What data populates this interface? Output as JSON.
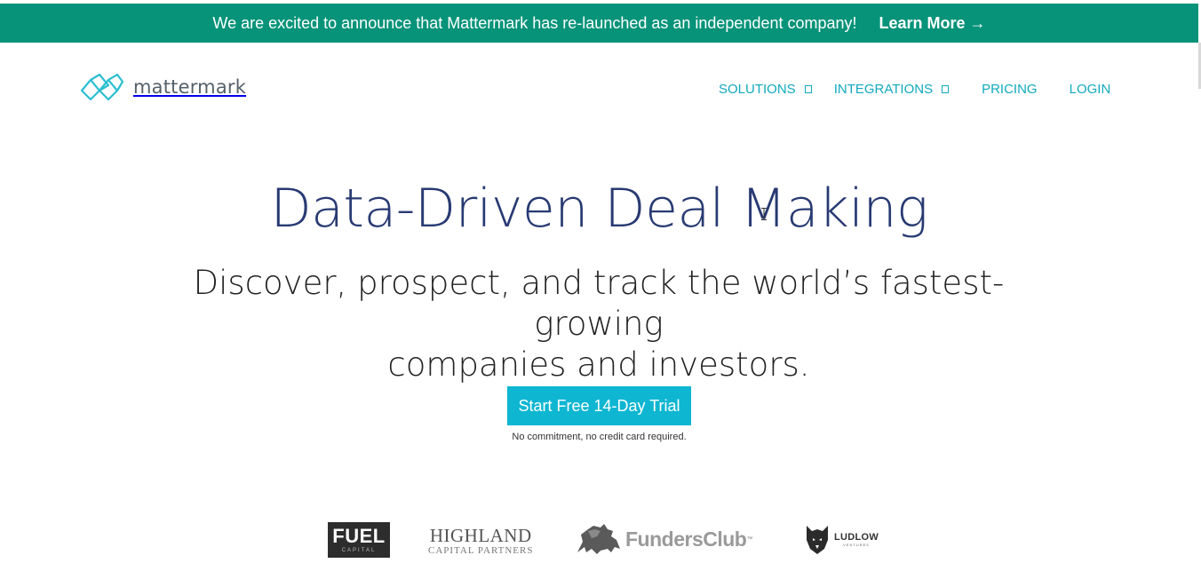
{
  "announcement": {
    "message": "We are excited to announce that Mattermark has re-launched as an independent company!",
    "link_label": "Learn More →"
  },
  "brand": {
    "name": "mattermark",
    "icon": "mattermark-logo-icon",
    "accent_color": "#11a9bd",
    "banner_color": "#069379",
    "cta_color": "#0eb6d2",
    "title_color": "#283a72"
  },
  "nav": {
    "solutions": "SOLUTIONS",
    "integrations": "INTEGRATIONS",
    "pricing": "PRICING",
    "login": "LOGIN"
  },
  "hero": {
    "title": "Data-Driven Deal Making",
    "subtitle_line1": "Discover, prospect, and track the world’s fastest-growing",
    "subtitle_line2": "companies and investors.",
    "cta_label": "Start Free 14-Day Trial",
    "cta_note": "No commitment, no credit card required."
  },
  "customer_logos": {
    "fuel": {
      "name": "FUEL",
      "sub": "CAPITAL"
    },
    "highland": {
      "name": "HIGHLAND",
      "sub": "CAPITAL PARTNERS"
    },
    "funders": {
      "name": "FundersClub",
      "tm": "™",
      "icon": "lion-icon"
    },
    "ludlow": {
      "name": "LUDLOW",
      "sub": "VENTURES",
      "icon": "wolf-icon"
    }
  }
}
